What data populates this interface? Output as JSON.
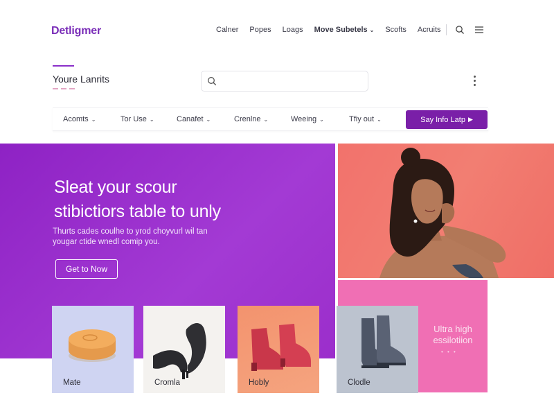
{
  "brand": {
    "logo_text": "Detligmer",
    "accent_color": "#7a2db8"
  },
  "topnav": {
    "items": [
      {
        "label": "Calner"
      },
      {
        "label": "Popes"
      },
      {
        "label": "Loags"
      },
      {
        "label": "Move Subetels"
      },
      {
        "label": "Scofts"
      },
      {
        "label": "Acruits"
      }
    ]
  },
  "section": {
    "title": "Youre Lanrits"
  },
  "search": {
    "value": "",
    "placeholder": ""
  },
  "filters": {
    "items": [
      {
        "label": "Acomts"
      },
      {
        "label": "Tor Use"
      },
      {
        "label": "Canafet"
      },
      {
        "label": "Crenlne"
      },
      {
        "label": "Weeing"
      },
      {
        "label": "Tfiy out"
      }
    ],
    "cta_label": "Say Info Latp",
    "cta_color": "#7a1fa8"
  },
  "hero": {
    "headline_line1": "Sleat your scour",
    "headline_line2": "stibictiors table to unly",
    "subtext_line1": "Thurts cades coulhe to yrod choyvurl wil tan",
    "subtext_line2": "yougar ctide wnedl comip you.",
    "button_label": "Get to Now",
    "bg_color": "#9a2ccc"
  },
  "promo": {
    "line1": "Ultra high",
    "line2": "essilotiion",
    "dots": "• • •",
    "bg_color": "#f06fb4"
  },
  "products": [
    {
      "label": "Mate",
      "icon": "cushion-product-icon"
    },
    {
      "label": "Cromla",
      "icon": "heels-product-icon"
    },
    {
      "label": "Hobly",
      "icon": "red-boots-product-icon"
    },
    {
      "label": "Clodle",
      "icon": "grey-boots-product-icon"
    }
  ]
}
